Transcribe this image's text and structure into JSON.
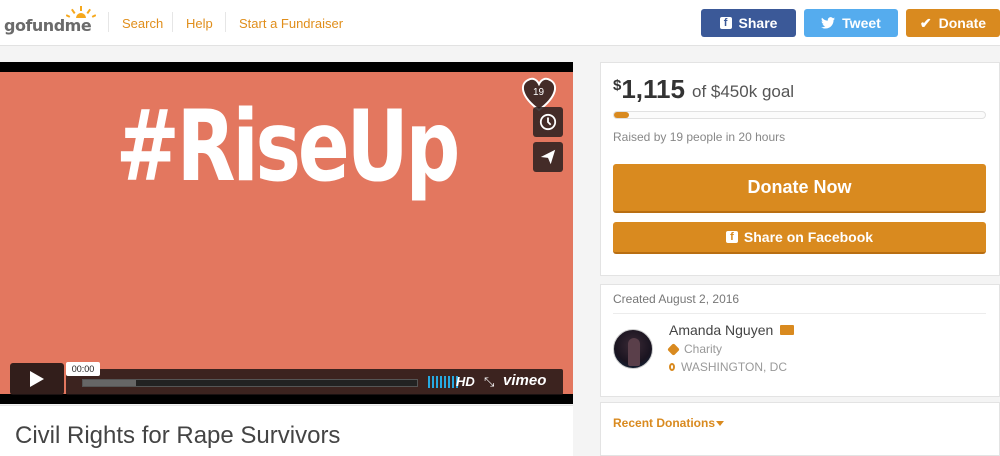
{
  "header": {
    "logo": {
      "go": "go",
      "fund": "fund",
      "me": "me"
    },
    "nav": [
      "Search",
      "Help",
      "Start a Fundraiser"
    ],
    "buttons": {
      "share": "Share",
      "tweet": "Tweet",
      "donate": "Donate"
    }
  },
  "video": {
    "overlay_text": "#RiseUp",
    "likes": "19",
    "time": "00:00",
    "hd": "HD",
    "brand": "vimeo",
    "progress": 0.16
  },
  "campaign": {
    "title": "Civil Rights for Rape Survivors",
    "amount_symbol": "$",
    "amount": "1,115",
    "goal_text": "of $450k goal",
    "progress_fraction": 0.04,
    "raised_by": "Raised by 19 people in 20 hours",
    "donate_now": "Donate Now",
    "share_facebook": "Share on Facebook"
  },
  "organizer": {
    "created": "Created August 2, 2016",
    "name": "Amanda Nguyen",
    "category": "Charity",
    "location": "WASHINGTON, DC"
  },
  "donations": {
    "recent_label": "Recent Donations"
  },
  "colors": {
    "accent": "#d98a1f",
    "facebook": "#3b5998",
    "twitter": "#55acee",
    "video_bg": "#e3775f"
  }
}
